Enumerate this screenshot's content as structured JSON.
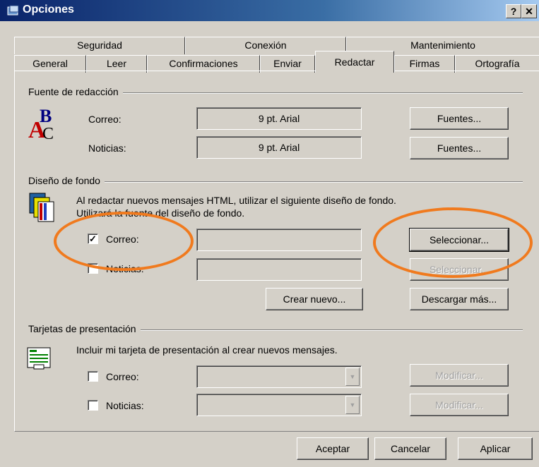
{
  "window": {
    "title": "Opciones",
    "help_btn": "?",
    "close_btn": "✕"
  },
  "tabs_row1": [
    "Seguridad",
    "Conexión",
    "Mantenimiento"
  ],
  "tabs_row2": [
    "General",
    "Leer",
    "Confirmaciones",
    "Enviar",
    "Redactar",
    "Firmas",
    "Ortografía"
  ],
  "active_tab": "Redactar",
  "font_group": {
    "label": "Fuente de redacción",
    "mail_label": "Correo:",
    "mail_font": "9 pt. Arial",
    "news_label": "Noticias:",
    "news_font": "9 pt. Arial",
    "fonts_btn": "Fuentes..."
  },
  "stationery_group": {
    "label": "Diseño de fondo",
    "line1": "Al redactar nuevos mensajes HTML, utilizar el siguiente diseño de fondo.",
    "line2": "Utilizará la fuente del diseño de fondo.",
    "mail_label": "Correo:",
    "mail_checked": true,
    "news_label": "Noticias:",
    "news_checked": false,
    "select_btn": "Seleccionar...",
    "create_btn": "Crear nuevo...",
    "download_btn": "Descargar más..."
  },
  "cards_group": {
    "label": "Tarjetas de presentación",
    "desc": "Incluir mi tarjeta de presentación al crear nuevos mensajes.",
    "mail_label": "Correo:",
    "news_label": "Noticias:",
    "modify_btn": "Modificar..."
  },
  "footer": {
    "ok": "Aceptar",
    "cancel": "Cancelar",
    "apply": "Aplicar"
  },
  "colors": {
    "highlight": "#f07a1e",
    "title_bar": "#0a246a"
  }
}
